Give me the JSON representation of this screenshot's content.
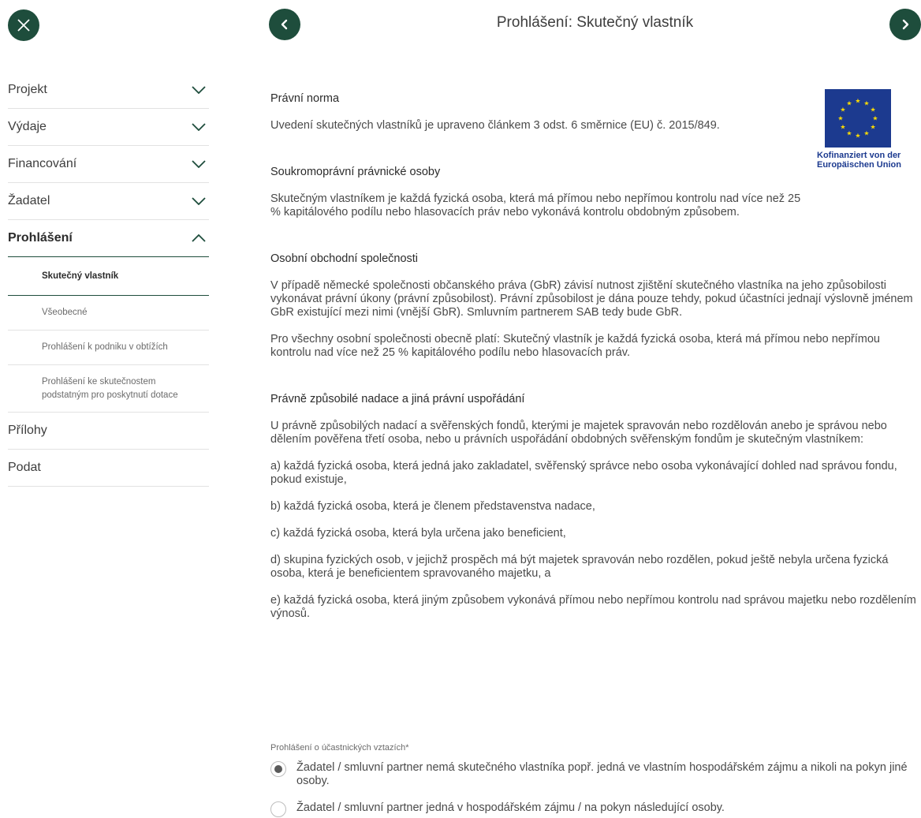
{
  "header": {
    "title": "Prohlášení: Skutečný vlastník"
  },
  "sidebar": {
    "items": [
      {
        "label": "Projekt"
      },
      {
        "label": "Výdaje"
      },
      {
        "label": "Financování"
      },
      {
        "label": "Žadatel"
      },
      {
        "label": "Prohlášení"
      }
    ],
    "sub_items": [
      {
        "label": "Skutečný vlastník"
      },
      {
        "label": "Všeobecné"
      },
      {
        "label": "Prohlášení k podniku v obtížích"
      },
      {
        "label": "Prohlášení ke skutečnostem podstatným pro poskytnutí dotace"
      }
    ],
    "bottom_items": [
      {
        "label": "Přílohy"
      },
      {
        "label": "Podat"
      }
    ]
  },
  "eu_logo": {
    "caption_line1": "Kofinanziert von der",
    "caption_line2": "Europäischen Union"
  },
  "content": {
    "s1_heading": "Právní norma",
    "s1_p1": "Uvedení skutečných vlastníků je upraveno článkem 3 odst. 6 směrnice (EU) č. 2015/849.",
    "s2_heading": "Soukromoprávní právnické osoby",
    "s2_p1": "Skutečným vlastníkem je každá fyzická osoba, která má přímou nebo nepřímou kontrolu nad více než 25 % kapitálového podílu nebo hlasovacích práv nebo vykonává kontrolu obdobným způsobem.",
    "s3_heading": "Osobní obchodní společnosti",
    "s3_p1": "V případě německé společnosti občanského práva (GbR) závisí nutnost zjištění skutečného vlastníka na jeho způsobilosti vykonávat právní úkony (právní způsobilost). Právní způsobilost je dána pouze tehdy, pokud účastníci jednají výslovně jménem GbR existující mezi nimi (vnější GbR). Smluvním partnerem SAB tedy bude GbR.",
    "s3_p2": "Pro všechny osobní společnosti obecně platí: Skutečný vlastník je každá fyzická osoba, která má přímou nebo nepřímou kontrolu nad více než 25 % kapitálového podílu nebo hlasovacích práv.",
    "s4_heading": "Právně způsobilé nadace a jiná právní uspořádání",
    "s4_p1": "U právně způsobilých nadací a svěřenských fondů, kterými je majetek spravován nebo rozdělován anebo je správou nebo dělením pověřena třetí osoba, nebo u právních uspořádání obdobných svěřenským fondům je skutečným vlastníkem:",
    "s4_a": "a) každá fyzická osoba, která jedná jako zakladatel, svěřenský správce nebo osoba vykonávající dohled nad správou fondu, pokud existuje,",
    "s4_b": "b) každá fyzická osoba, která je členem představenstva nadace,",
    "s4_c": "c) každá fyzická osoba, která byla určena jako beneficient,",
    "s4_d": "d) skupina fyzických osob, v jejichž prospěch má být majetek spravován nebo rozdělen, pokud ještě nebyla určena fyzická osoba, která je beneficientem spravovaného majetku, a",
    "s4_e": "e) každá fyzická osoba, která jiným způsobem vykonává přímou nebo nepřímou kontrolu nad správou majetku nebo rozdělením výnosů."
  },
  "form": {
    "label": "Prohlášení o účastnických vztazích*",
    "option1": "Žadatel / smluvní partner nemá skutečného vlastníka popř. jedná ve vlastním hospodářském zájmu a nikoli na pokyn jiné osoby.",
    "option2": "Žadatel / smluvní partner jedná v hospodářském zájmu / na pokyn následující osoby."
  },
  "colors": {
    "accent": "#1e4d3c",
    "eu_blue": "#1c3a8f",
    "eu_star": "#ffdd00"
  }
}
